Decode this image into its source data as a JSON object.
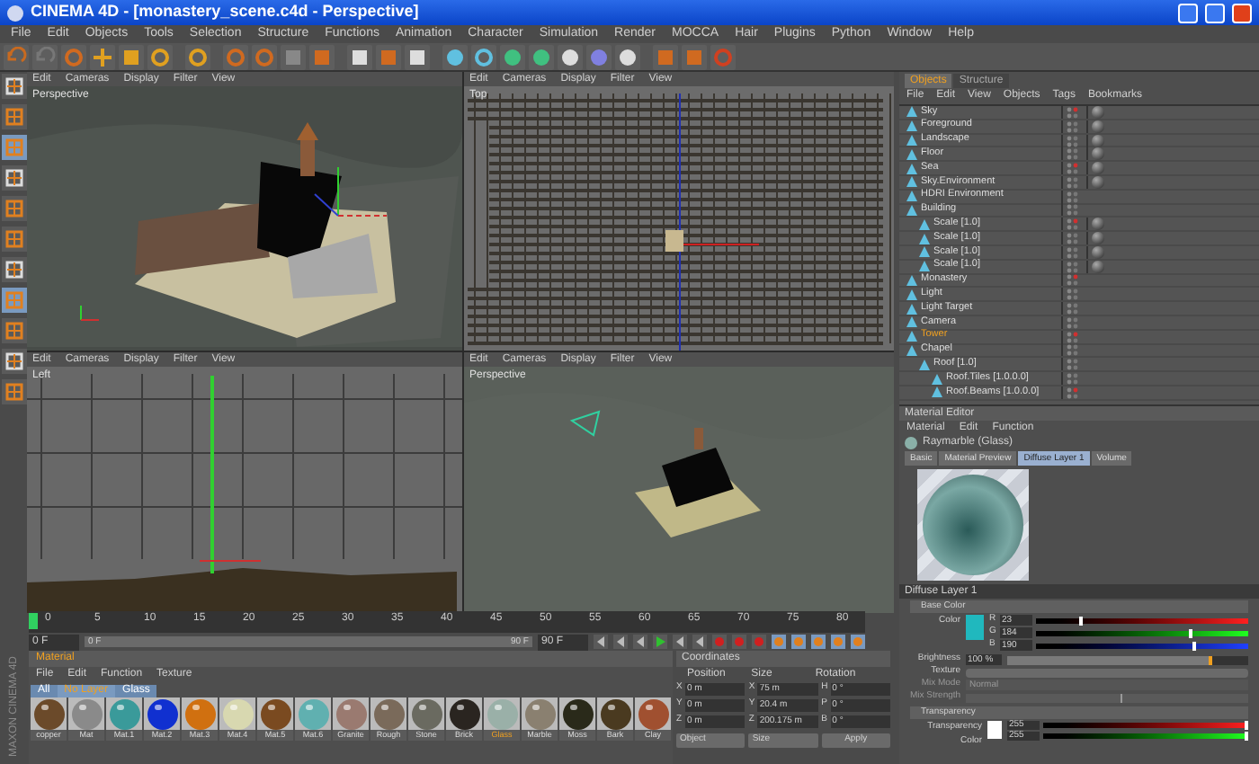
{
  "window": {
    "title": "CINEMA 4D - [monastery_scene.c4d - Perspective]"
  },
  "menu": [
    "File",
    "Edit",
    "Objects",
    "Tools",
    "Selection",
    "Structure",
    "Functions",
    "Animation",
    "Character",
    "Simulation",
    "Render",
    "MOCCA",
    "Hair",
    "Plugins",
    "Python",
    "Window",
    "Help"
  ],
  "viewports": [
    {
      "kind": "perspective",
      "label": "Perspective",
      "menu": [
        "Edit",
        "Cameras",
        "Display",
        "Filter",
        "View"
      ]
    },
    {
      "kind": "top",
      "label": "Top",
      "menu": [
        "Edit",
        "Cameras",
        "Display",
        "Filter",
        "View"
      ]
    },
    {
      "kind": "side",
      "label": "Left",
      "menu": [
        "Edit",
        "Cameras",
        "Display",
        "Filter",
        "View"
      ]
    },
    {
      "kind": "perspective_far",
      "label": "Perspective",
      "menu": [
        "Edit",
        "Cameras",
        "Display",
        "Filter",
        "View"
      ]
    }
  ],
  "object_manager": {
    "tabs": [
      {
        "label": "Objects",
        "selected": true
      },
      {
        "label": "Structure",
        "selected": false
      }
    ],
    "menu": [
      "File",
      "Edit",
      "View",
      "Objects",
      "Tags",
      "Bookmarks"
    ],
    "objects": [
      {
        "name": "Sky"
      },
      {
        "name": "Foreground"
      },
      {
        "name": "Landscape"
      },
      {
        "name": "Floor"
      },
      {
        "name": "Sea"
      },
      {
        "name": "Sky.Environment"
      },
      {
        "name": "HDRI Environment"
      },
      {
        "name": "Building",
        "children": [
          {
            "name": "Scale [1.0]"
          },
          {
            "name": "Scale [1.0]"
          },
          {
            "name": "Scale [1.0]"
          },
          {
            "name": "Scale [1.0]"
          }
        ]
      },
      {
        "name": "Monastery"
      },
      {
        "name": "Light"
      },
      {
        "name": "Light Target"
      },
      {
        "name": "Camera"
      },
      {
        "name": "Tower",
        "selected": true
      },
      {
        "name": "Chapel",
        "children": [
          {
            "name": "Roof [1.0]",
            "children": [
              {
                "name": "Roof.Tiles [1.0.0.0]"
              },
              {
                "name": "Roof.Beams [1.0.0.0]"
              }
            ]
          }
        ]
      }
    ]
  },
  "material_editor": {
    "title": "Material Editor",
    "menu": [
      "Material",
      "Edit",
      "Function"
    ],
    "material_name": "Raymarble (Glass)",
    "tabs": [
      {
        "label": "Basic",
        "selected": false
      },
      {
        "label": "Material Preview",
        "selected": false
      },
      {
        "label": "Diffuse Layer 1",
        "selected": true
      },
      {
        "label": "Volume",
        "selected": false
      }
    ],
    "layer_title": "Diffuse Layer 1",
    "section": "Base Color",
    "color_label": "Color",
    "channels": [
      {
        "name": "R",
        "value": "23",
        "level": 0.2
      },
      {
        "name": "G",
        "value": "184",
        "level": 0.72
      },
      {
        "name": "B",
        "value": "190",
        "level": 0.74
      }
    ],
    "brightness": {
      "label": "Brightness",
      "value": "100 %",
      "level": 0.85
    },
    "texture_label": "Texture",
    "mix_mode": {
      "label": "Mix Mode",
      "value": "Normal"
    },
    "mix_strength": {
      "label": "Mix Strength",
      "level": 0.55
    },
    "section2": "Transparency",
    "trans_label": "Transparency Color",
    "trans_values": [
      {
        "value": "255",
        "level": 1
      },
      {
        "value": "255",
        "level": 1
      }
    ]
  },
  "timeline": {
    "ticks": [
      "0",
      "5",
      "10",
      "15",
      "20",
      "25",
      "30",
      "35",
      "40",
      "45",
      "50",
      "55",
      "60",
      "65",
      "70",
      "75",
      "80"
    ],
    "playhead": {
      "level": 0.0
    },
    "current": "0 F",
    "start": "0 F",
    "end": "90 F",
    "range_end": "90 F",
    "range": {
      "level": 1
    }
  },
  "material_browser": {
    "title": "Material",
    "menu": [
      "File",
      "Edit",
      "Function",
      "Texture"
    ],
    "tabs": [
      {
        "label": "All",
        "selected": false
      },
      {
        "label": "No Layer",
        "selected": true
      },
      {
        "label": "Glass",
        "selected": false
      }
    ],
    "materials": [
      {
        "name": "copper",
        "color": "#6b4a2a",
        "selected": false
      },
      {
        "name": "Mat",
        "color": "#8a8a8a",
        "selected": false
      },
      {
        "name": "Mat.1",
        "color": "#3a9a9a",
        "selected": false
      },
      {
        "name": "Mat.2",
        "color": "#1030d0",
        "selected": false
      },
      {
        "name": "Mat.3",
        "color": "#d07010",
        "selected": false
      },
      {
        "name": "Mat.4",
        "color": "#d8d8b0",
        "selected": false
      },
      {
        "name": "Mat.5",
        "color": "#7a4a20",
        "selected": false
      },
      {
        "name": "Mat.6",
        "color": "#60b0b0",
        "selected": false
      },
      {
        "name": "Granite",
        "color": "#9a7a70",
        "selected": false
      },
      {
        "name": "Rough",
        "color": "#7a6a5a",
        "selected": false
      },
      {
        "name": "Stone",
        "color": "#6a6a60",
        "selected": false
      },
      {
        "name": "Brick",
        "color": "#2a2520",
        "selected": false
      },
      {
        "name": "Glass",
        "color": "#9ab0a8",
        "selected": true
      },
      {
        "name": "Marble",
        "color": "#8a8070",
        "selected": false
      },
      {
        "name": "Moss",
        "color": "#2a2a1a",
        "selected": false
      },
      {
        "name": "Bark",
        "color": "#4a3a20",
        "selected": false
      },
      {
        "name": "Clay",
        "color": "#a05030",
        "selected": false
      }
    ]
  },
  "coordinates": {
    "title": "Coordinates",
    "headers": [
      "Position",
      "Size",
      "Rotation"
    ],
    "rows": [
      {
        "axis": "X",
        "position": "0 m",
        "size_axis": "X",
        "size": "75 m",
        "rot_axis": "H",
        "rotation": "0 °"
      },
      {
        "axis": "Y",
        "position": "0 m",
        "size_axis": "Y",
        "size": "20.4 m",
        "rot_axis": "P",
        "rotation": "0 °"
      },
      {
        "axis": "Z",
        "position": "0 m",
        "size_axis": "Z",
        "size": "200.175 m",
        "rot_axis": "B",
        "rotation": "0 °"
      }
    ],
    "mode": "Object",
    "size_mode": "Size",
    "apply": "Apply"
  },
  "brand": "MAXON CINEMA 4D"
}
